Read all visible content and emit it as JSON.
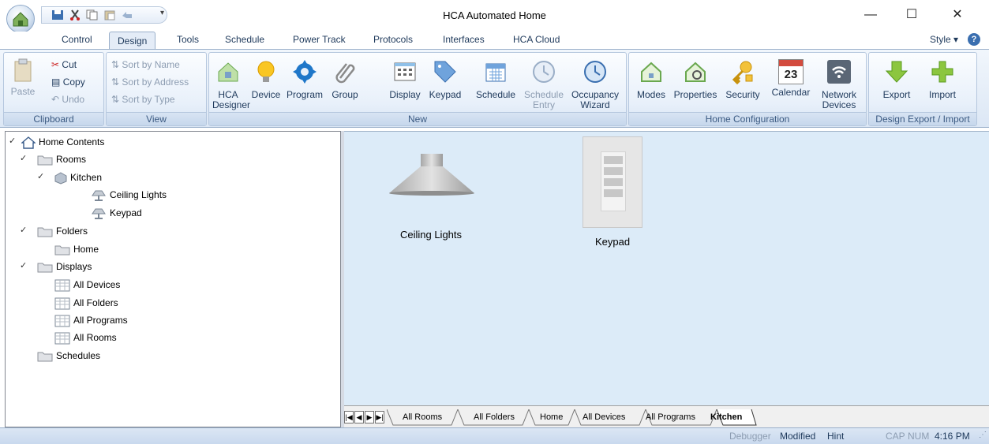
{
  "window": {
    "title": "HCA Automated Home",
    "minimize": "—",
    "maximize": "☐",
    "close": "✕"
  },
  "tabs": [
    "Control",
    "Design",
    "Tools",
    "Schedule",
    "Power Track",
    "Protocols",
    "Interfaces",
    "HCA Cloud"
  ],
  "style_menu": "Style",
  "ribbon": {
    "clipboard": {
      "label": "Clipboard",
      "paste": "Paste",
      "cut": "Cut",
      "copy": "Copy",
      "undo": "Undo"
    },
    "view": {
      "label": "View",
      "sort_name": "Sort by Name",
      "sort_address": "Sort by Address",
      "sort_type": "Sort by Type"
    },
    "new": {
      "label": "New",
      "hca_designer_1": "HCA",
      "hca_designer_2": "Designer",
      "device": "Device",
      "program": "Program",
      "group": "Group",
      "display": "Display",
      "keypad": "Keypad",
      "schedule": "Schedule",
      "schedule_entry_1": "Schedule",
      "schedule_entry_2": "Entry",
      "occupancy_1": "Occupancy",
      "occupancy_2": "Wizard"
    },
    "home_config": {
      "label": "Home Configuration",
      "modes": "Modes",
      "properties": "Properties",
      "security": "Security",
      "calendar": "Calendar",
      "calendar_day": "23",
      "network_1": "Network",
      "network_2": "Devices"
    },
    "design_export": {
      "label": "Design Export / Import",
      "export": "Export",
      "import": "Import"
    }
  },
  "tree": {
    "root": "Home Contents",
    "rooms": "Rooms",
    "kitchen": "Kitchen",
    "ceiling_lights": "Ceiling Lights",
    "keypad": "Keypad",
    "folders": "Folders",
    "home": "Home",
    "displays": "Displays",
    "all_devices": "All Devices",
    "all_folders": "All Folders",
    "all_programs": "All Programs",
    "all_rooms": "All Rooms",
    "schedules": "Schedules"
  },
  "view_items": {
    "ceiling_lights": "Ceiling Lights",
    "keypad": "Keypad"
  },
  "sheet_tabs": {
    "nav": [
      "|◀",
      "◀",
      "▶",
      "▶|"
    ],
    "tabs": [
      "All Rooms",
      "All Folders",
      "Home",
      "All Devices",
      "All Programs",
      "Kitchen"
    ],
    "active": "Kitchen"
  },
  "status": {
    "debugger": "Debugger",
    "modified": "Modified",
    "hint": "Hint",
    "cap": "CAP",
    "num": "NUM",
    "time": "4:16 PM"
  },
  "colors": {
    "accent": "#1e395b",
    "view_bg": "#dcebf8",
    "ribbon_bg": "#dce7f5"
  }
}
